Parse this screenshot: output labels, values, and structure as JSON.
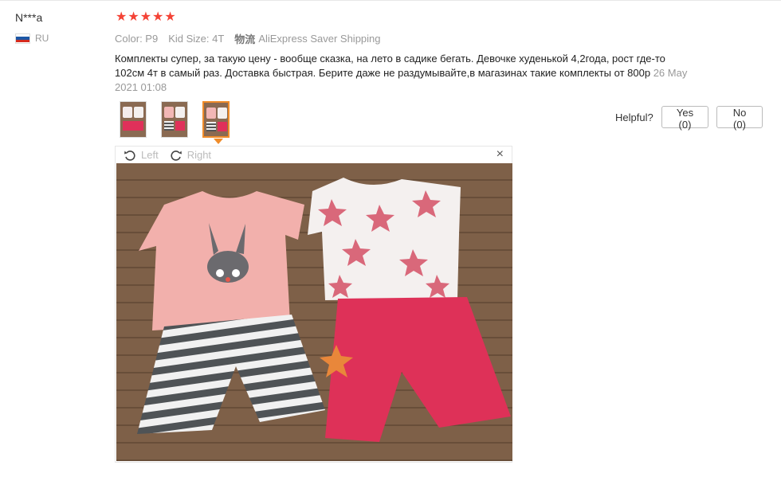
{
  "review": {
    "user_name": "N***a",
    "country": "RU",
    "rating": 5,
    "color_label": "Color: P9",
    "size_label": "Kid Size: 4T",
    "shipping_icon_text": "物流",
    "shipping": "AliExpress Saver Shipping",
    "feedback_text": "Комплекты супер, за такую цену - вообще сказка, на лето в садике бегать. Девочке худенькой 4,2года, рост где-то 102см 4т в самый раз. Доставка быстрая. Берите даже не раздумывайте,в магазинах такие комплекты от 800р",
    "date": "26 May 2021 01:08"
  },
  "helpful": {
    "label": "Helpful?",
    "yes_label": "Yes (0)",
    "no_label": "No (0)"
  },
  "viewer": {
    "rotate_left_label": "Left",
    "rotate_right_label": "Right",
    "close_symbol": "×"
  },
  "thumbnails": {
    "count": 3,
    "active_index": 2
  },
  "colors": {
    "star": "#f44336",
    "accent_orange": "#f08c2a",
    "muted_text": "#999999",
    "flag": [
      "#ffffff",
      "#1c57a5",
      "#d52b1e"
    ]
  },
  "icons": {
    "star": "star-icon",
    "flag": "russia-flag-icon",
    "rotate_left": "rotate-left-icon",
    "rotate_right": "rotate-right-icon",
    "close": "close-icon"
  }
}
